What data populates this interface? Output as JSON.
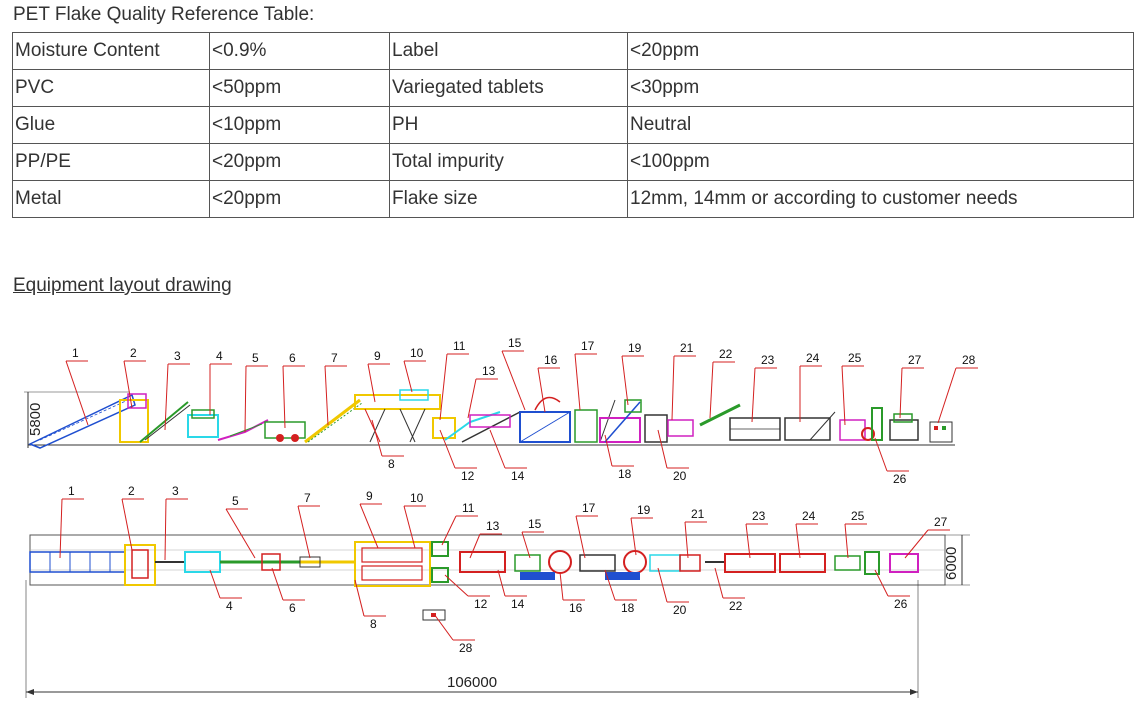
{
  "page": {
    "title": "PET Flake Quality Reference Table:",
    "section_title": "Equipment layout drawing"
  },
  "quality_table": {
    "rows": [
      [
        "Moisture Content",
        "<0.9%",
        "Label",
        "<20ppm"
      ],
      [
        "PVC",
        "<50ppm",
        "Variegated tablets",
        "<30ppm"
      ],
      [
        "Glue",
        "<10ppm",
        "PH",
        "Neutral"
      ],
      [
        "PP/PE",
        "<20ppm",
        "Total impurity",
        "<100ppm"
      ],
      [
        "Metal",
        "<20ppm",
        "Flake size",
        "12mm, 14mm or according to customer needs"
      ]
    ]
  },
  "drawing": {
    "dimensions": {
      "side_height": "5800",
      "top_width": "6000",
      "total_length": "106000"
    },
    "side_view_labels": [
      "1",
      "2",
      "3",
      "4",
      "5",
      "6",
      "7",
      "8",
      "9",
      "10",
      "11",
      "12",
      "13",
      "14",
      "15",
      "16",
      "17",
      "18",
      "19",
      "20",
      "21",
      "22",
      "23",
      "24",
      "25",
      "26",
      "27",
      "28"
    ],
    "top_view_labels": [
      "1",
      "2",
      "3",
      "4",
      "5",
      "6",
      "7",
      "8",
      "9",
      "10",
      "11",
      "12",
      "13",
      "14",
      "15",
      "16",
      "17",
      "18",
      "19",
      "20",
      "21",
      "22",
      "23",
      "24",
      "25",
      "26",
      "27",
      "28"
    ],
    "colors": {
      "leader": "#d42020",
      "conveyor": "#1f4fd0",
      "yellow": "#f0c800",
      "green": "#2a9a2a",
      "cyan": "#2ad8e8",
      "magenta": "#d020c0",
      "outline": "#333333"
    }
  }
}
